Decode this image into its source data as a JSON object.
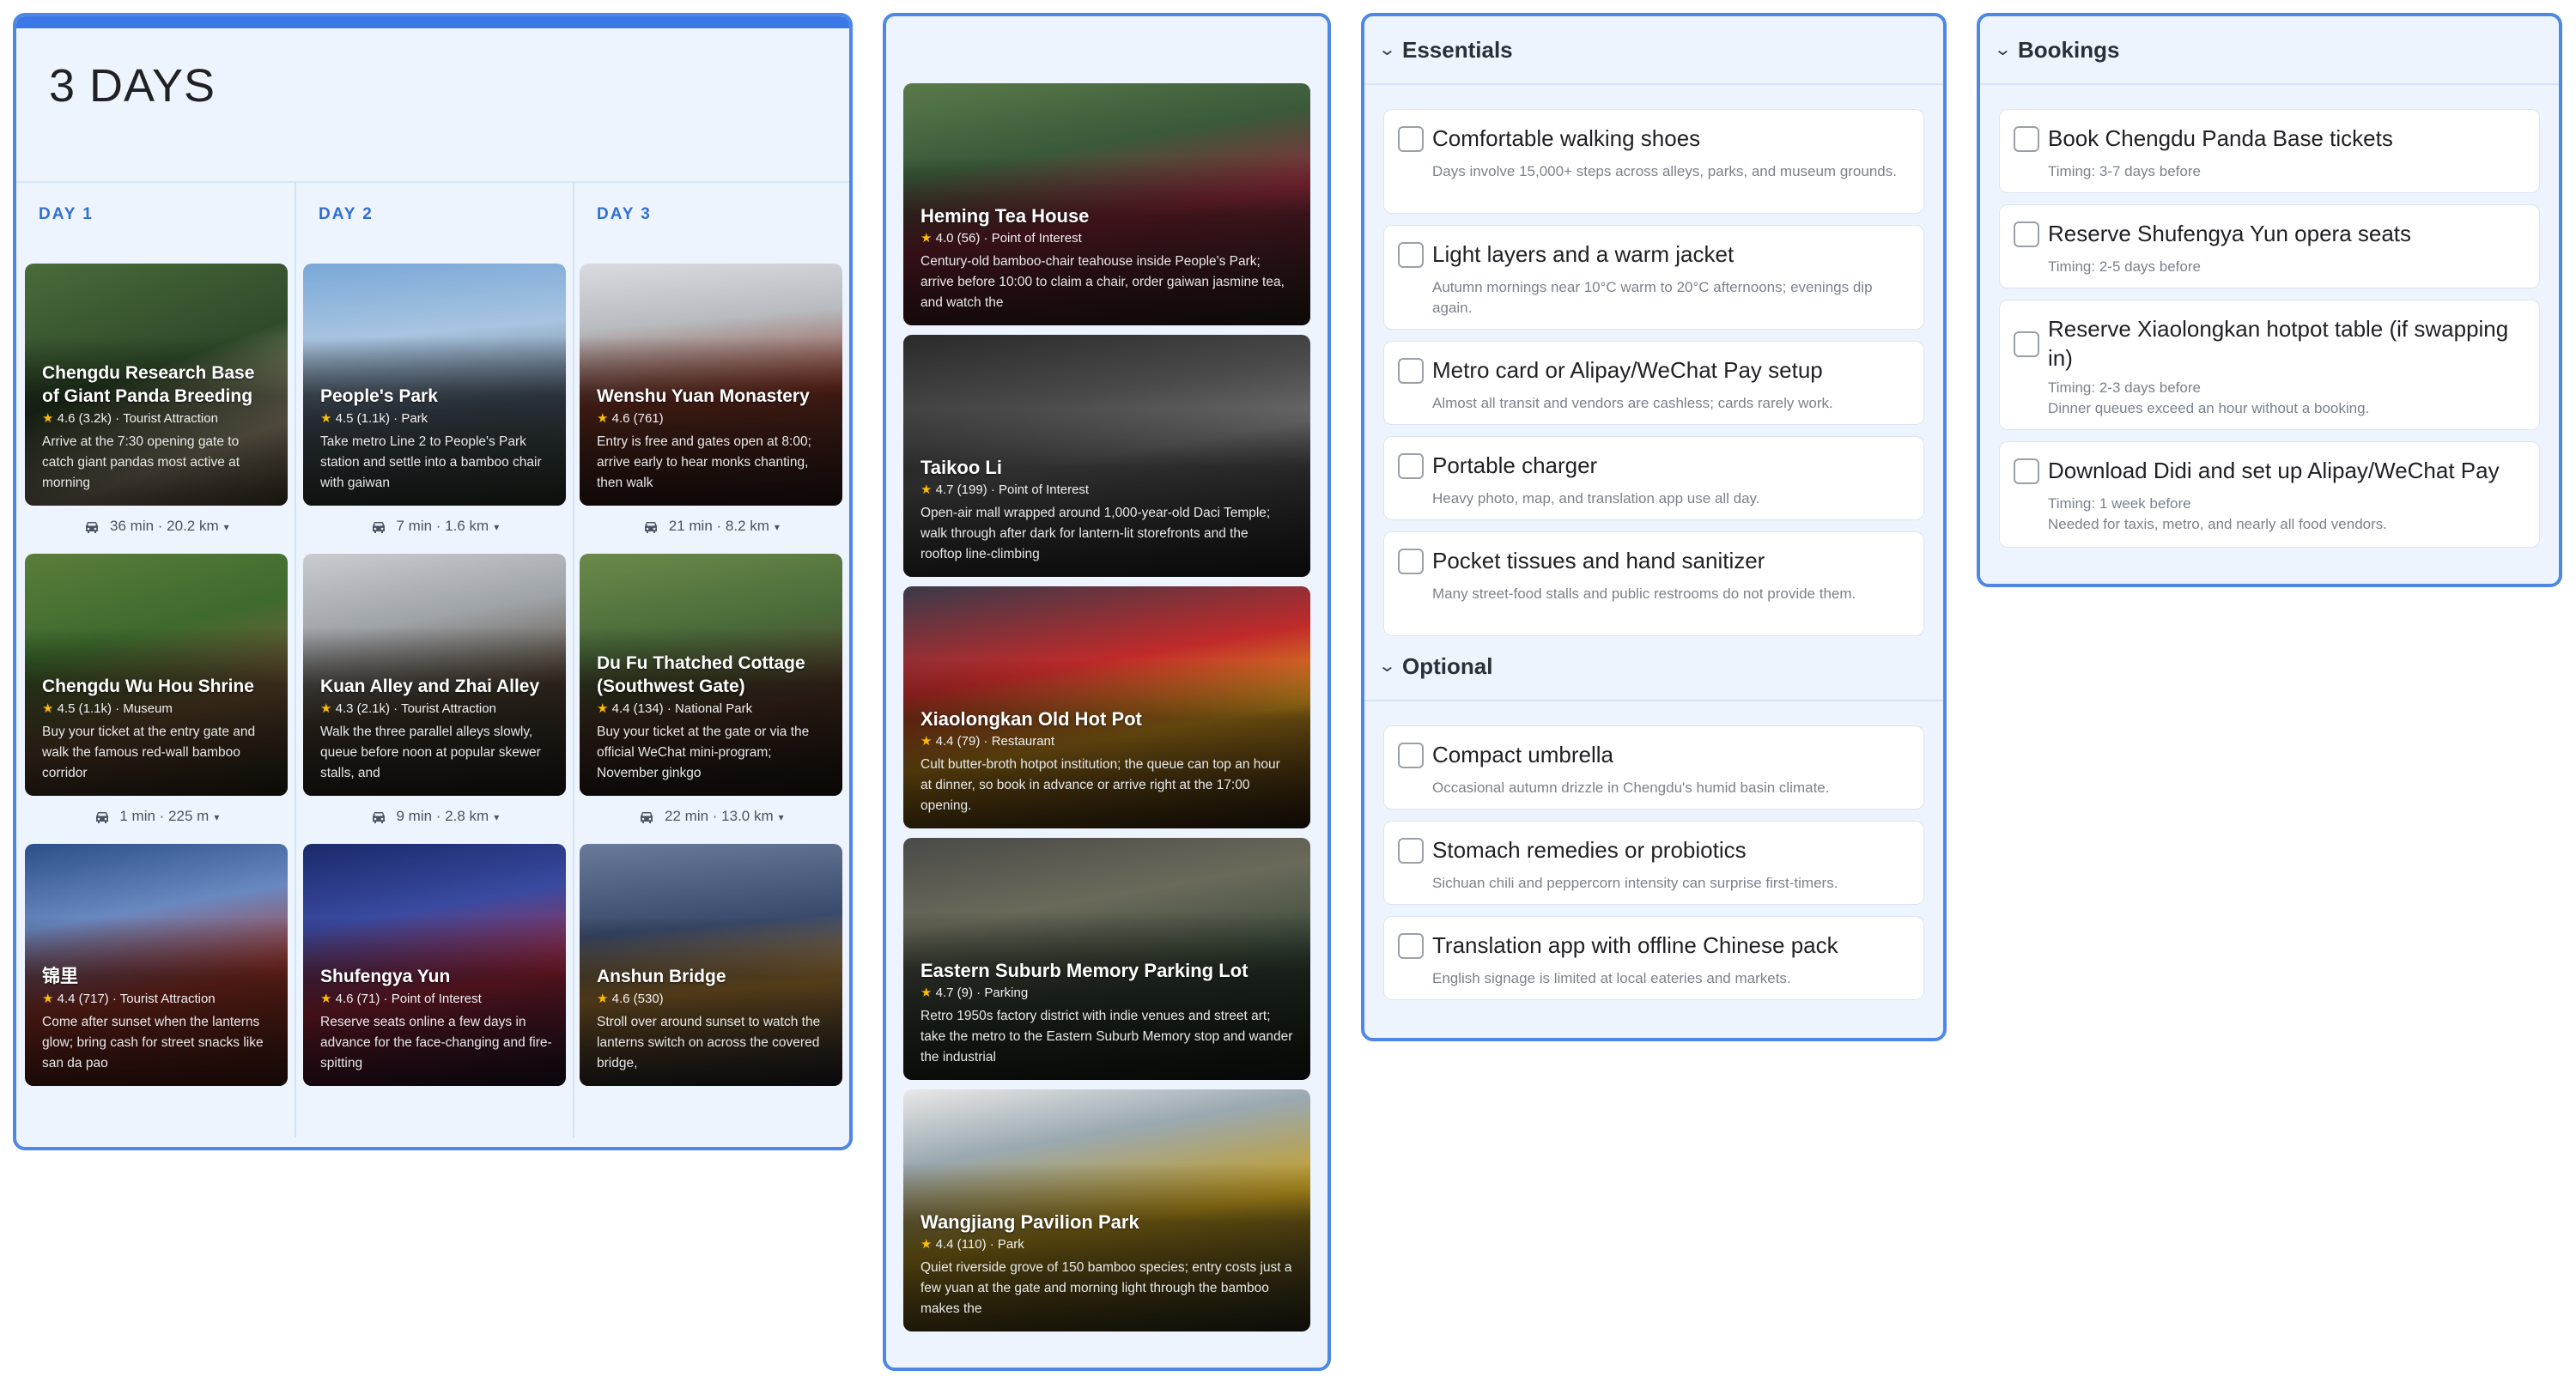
{
  "trip": {
    "title": "3 DAYS"
  },
  "days": [
    {
      "label": "DAY 1",
      "places": [
        {
          "name": "Chengdu Research Base of Giant Panda Breeding",
          "rating": "4.6",
          "reviews": "(3.2k)",
          "category": "Tourist Attraction",
          "desc": "Arrive at the 7:30 opening gate to catch giant pandas most active at morning"
        },
        {
          "name": "Chengdu Wu Hou Shrine",
          "rating": "4.5",
          "reviews": "(1.1k)",
          "category": "Museum",
          "desc": "Buy your ticket at the entry gate and walk the famous red-wall bamboo corridor"
        },
        {
          "name": "锦里",
          "rating": "4.4",
          "reviews": "(717)",
          "category": "Tourist Attraction",
          "desc": "Come after sunset when the lanterns glow; bring cash for street snacks like san da pao"
        }
      ],
      "transits": [
        "36 min · 20.2 km",
        "1 min · 225 m"
      ]
    },
    {
      "label": "DAY 2",
      "places": [
        {
          "name": "People's Park",
          "rating": "4.5",
          "reviews": "(1.1k)",
          "category": "Park",
          "desc": "Take metro Line 2 to People's Park station and settle into a bamboo chair with gaiwan"
        },
        {
          "name": "Kuan Alley and Zhai Alley",
          "rating": "4.3",
          "reviews": "(2.1k)",
          "category": "Tourist Attraction",
          "desc": "Walk the three parallel alleys slowly, queue before noon at popular skewer stalls, and"
        },
        {
          "name": "Shufengya Yun",
          "rating": "4.6",
          "reviews": "(71)",
          "category": "Point of Interest",
          "desc": "Reserve seats online a few days in advance for the face-changing and fire-spitting"
        }
      ],
      "transits": [
        "7 min · 1.6 km",
        "9 min · 2.8 km"
      ]
    },
    {
      "label": "DAY 3",
      "places": [
        {
          "name": "Wenshu Yuan Monastery",
          "rating": "4.6",
          "reviews": "(761)",
          "category": "",
          "desc": "Entry is free and gates open at 8:00; arrive early to hear monks chanting, then walk"
        },
        {
          "name": "Du Fu Thatched Cottage (Southwest Gate)",
          "rating": "4.4",
          "reviews": "(134)",
          "category": "National Park",
          "desc": "Buy your ticket at the gate or via the official WeChat mini-program; November ginkgo"
        },
        {
          "name": "Anshun Bridge",
          "rating": "4.6",
          "reviews": "(530)",
          "category": "",
          "desc": "Stroll over around sunset to watch the lanterns switch on across the covered bridge,"
        }
      ],
      "transits": [
        "21 min · 8.2 km",
        "22 min · 13.0 km"
      ]
    }
  ],
  "extra_places": [
    {
      "name": "Heming Tea House",
      "rating": "4.0",
      "reviews": "(56)",
      "category": "Point of Interest",
      "desc": "Century-old bamboo-chair teahouse inside People's Park; arrive before 10:00 to claim a chair, order gaiwan jasmine tea, and watch the"
    },
    {
      "name": "Taikoo Li",
      "rating": "4.7",
      "reviews": "(199)",
      "category": "Point of Interest",
      "desc": "Open-air mall wrapped around 1,000-year-old Daci Temple; walk through after dark for lantern-lit storefronts and the rooftop line-climbing"
    },
    {
      "name": "Xiaolongkan Old Hot Pot",
      "rating": "4.4",
      "reviews": "(79)",
      "category": "Restaurant",
      "desc": "Cult butter-broth hotpot institution; the queue can top an hour at dinner, so book in advance or arrive right at the 17:00 opening."
    },
    {
      "name": "Eastern Suburb Memory Parking Lot",
      "rating": "4.7",
      "reviews": "(9)",
      "category": "Parking",
      "desc": "Retro 1950s factory district with indie venues and street art; take the metro to the Eastern Suburb Memory stop and wander the industrial"
    },
    {
      "name": "Wangjiang Pavilion Park",
      "rating": "4.4",
      "reviews": "(110)",
      "category": "Park",
      "desc": "Quiet riverside grove of 150 bamboo species; entry costs just a few yuan at the gate and morning light through the bamboo makes the"
    }
  ],
  "essentials": {
    "title": "Essentials",
    "items": [
      {
        "title": "Comfortable walking shoes",
        "sub": "Days involve 15,000+ steps across alleys, parks, and museum grounds."
      },
      {
        "title": "Light layers and a warm jacket",
        "sub": "Autumn mornings near 10°C warm to 20°C afternoons; evenings dip again."
      },
      {
        "title": "Metro card or Alipay/WeChat Pay setup",
        "sub": "Almost all transit and vendors are cashless; cards rarely work."
      },
      {
        "title": "Portable charger",
        "sub": "Heavy photo, map, and translation app use all day."
      },
      {
        "title": "Pocket tissues and hand sanitizer",
        "sub": "Many street-food stalls and public restrooms do not provide them."
      }
    ]
  },
  "optional": {
    "title": "Optional",
    "items": [
      {
        "title": "Compact umbrella",
        "sub": "Occasional autumn drizzle in Chengdu's humid basin climate."
      },
      {
        "title": "Stomach remedies or probiotics",
        "sub": "Sichuan chili and peppercorn intensity can surprise first-timers."
      },
      {
        "title": "Translation app with offline Chinese pack",
        "sub": "English signage is limited at local eateries and markets."
      }
    ]
  },
  "bookings": {
    "title": "Bookings",
    "items": [
      {
        "title": "Book Chengdu Panda Base tickets",
        "timing": "Timing: 3-7 days before",
        "note": ""
      },
      {
        "title": "Reserve Shufengya Yun opera seats",
        "timing": "Timing: 2-5 days before",
        "note": ""
      },
      {
        "title": "Reserve Xiaolongkan hotpot table (if swapping in)",
        "timing": "Timing: 2-3 days before",
        "note": "Dinner queues exceed an hour without a booking."
      },
      {
        "title": "Download Didi and set up Alipay/WeChat Pay",
        "timing": "Timing: 1 week before",
        "note": "Needed for taxis, metro, and nearly all food vendors."
      }
    ]
  },
  "theme": {
    "accent": "#3b78e7",
    "panel_bg": "#eef4fd",
    "star": "#fbbc04",
    "day_label": "#2f6fd6"
  }
}
